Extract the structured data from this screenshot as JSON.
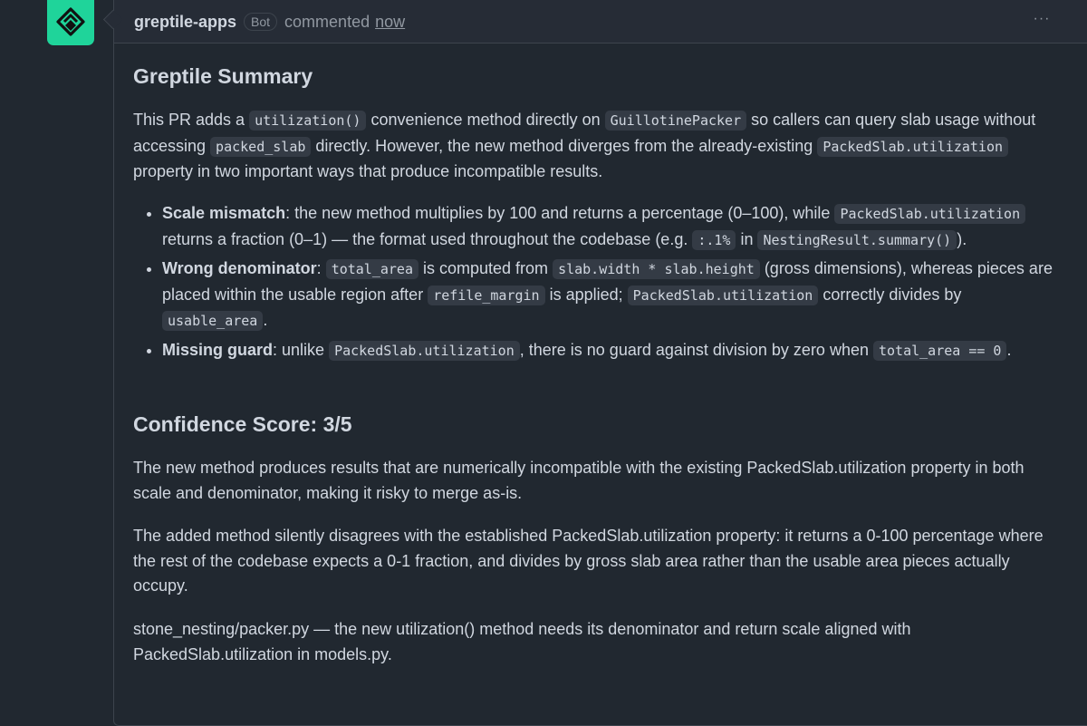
{
  "comment": {
    "author": "greptile-apps",
    "badge": "Bot",
    "action": "commented",
    "time": "now",
    "menu": "···"
  },
  "summary": {
    "title": "Greptile Summary",
    "intro": [
      {
        "t": "This PR adds a "
      },
      {
        "c": "utilization()"
      },
      {
        "t": " convenience method directly on "
      },
      {
        "c": "GuillotinePacker"
      },
      {
        "t": " so callers can query slab usage without accessing "
      },
      {
        "c": "packed_slab"
      },
      {
        "t": " directly. However, the new method diverges from the already-existing "
      },
      {
        "c": "PackedSlab.utilization"
      },
      {
        "t": " property in two important ways that produce incompatible results."
      }
    ],
    "bullets": [
      [
        {
          "b": "Scale mismatch"
        },
        {
          "t": ": the new method multiplies by 100 and returns a percentage (0–100), while "
        },
        {
          "c": "PackedSlab.utilization"
        },
        {
          "t": " returns a fraction (0–1) — the format used throughout the codebase (e.g. "
        },
        {
          "c": ":.1%"
        },
        {
          "t": " in "
        },
        {
          "c": "NestingResult.summary()"
        },
        {
          "t": ")."
        }
      ],
      [
        {
          "b": "Wrong denominator"
        },
        {
          "t": ": "
        },
        {
          "c": "total_area"
        },
        {
          "t": " is computed from "
        },
        {
          "c": "slab.width * slab.height"
        },
        {
          "t": " (gross dimensions), whereas pieces are placed within the usable region after "
        },
        {
          "c": "refile_margin"
        },
        {
          "t": " is applied; "
        },
        {
          "c": "PackedSlab.utilization"
        },
        {
          "t": " correctly divides by "
        },
        {
          "c": "usable_area"
        },
        {
          "t": "."
        }
      ],
      [
        {
          "b": "Missing guard"
        },
        {
          "t": ": unlike "
        },
        {
          "c": "PackedSlab.utilization"
        },
        {
          "t": ", there is no guard against division by zero when "
        },
        {
          "c": "total_area == 0"
        },
        {
          "t": "."
        }
      ]
    ]
  },
  "confidence": {
    "title": "Confidence Score: 3/5",
    "p1": "The new method produces results that are numerically incompatible with the existing PackedSlab.utilization property in both scale and denominator, making it risky to merge as-is.",
    "p2": "The added method silently disagrees with the established PackedSlab.utilization property: it returns a 0-100 percentage where the rest of the codebase expects a 0-1 fraction, and divides by gross slab area rather than the usable area pieces actually occupy.",
    "p3": "stone_nesting/packer.py — the new utilization() method needs its denominator and return scale aligned with PackedSlab.utilization in models.py."
  },
  "colors": {
    "background": "#212830",
    "header": "#262c36",
    "border": "#3d444d",
    "text": "#d1d7e0",
    "muted": "#9198a1",
    "avatar": "#1fd49a",
    "code_bg": "#343b45"
  },
  "icons": {
    "avatar": "greptile-logo-icon",
    "menu": "kebab-menu-icon"
  }
}
